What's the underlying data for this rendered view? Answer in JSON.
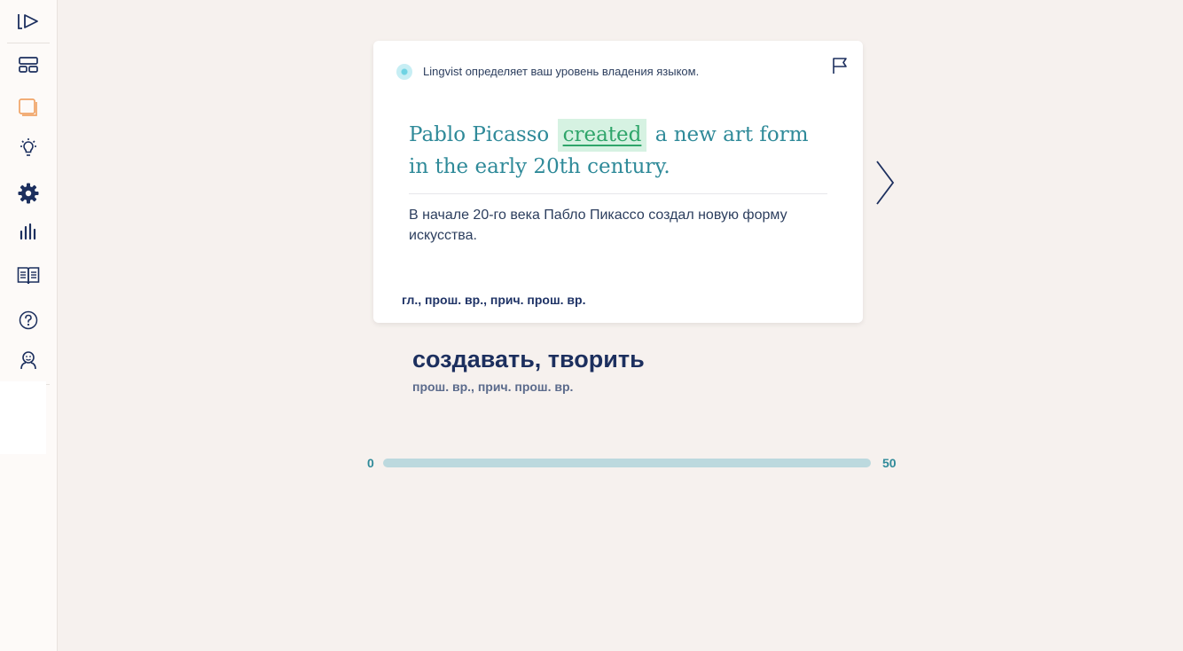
{
  "sidebar": {
    "items": [
      {
        "icon": "play-icon"
      },
      {
        "icon": "dashboard-icon"
      },
      {
        "icon": "cards-icon",
        "active_color": "#f0a466"
      },
      {
        "icon": "lightbulb-icon"
      },
      {
        "icon": "gear-icon"
      },
      {
        "icon": "stats-icon"
      },
      {
        "icon": "book-icon"
      },
      {
        "icon": "help-icon"
      },
      {
        "icon": "profile-icon"
      }
    ]
  },
  "card": {
    "status_text": "Lingvist определяет ваш уровень владения языком.",
    "sentence_before": "Pablo Picasso",
    "target_word": "created",
    "sentence_after": "a new art form in the early 20th century.",
    "translation": "В начале 20-го века Пабло Пикассо создал новую форму искусства.",
    "grammar": "гл., прош. вр., прич. прош. вр."
  },
  "meaning": {
    "word": "создавать, творить",
    "form": "прош. вр., прич. прош. вр."
  },
  "progress": {
    "min_label": "0",
    "max_label": "50",
    "fraction": 0
  },
  "colors": {
    "background": "#f6f1ee",
    "sentence": "#2f8a99",
    "target_highlight": "#d6f2e2",
    "target_text": "#2fa56a",
    "navy": "#1c2f5e",
    "accent_orange": "#f0a466",
    "progress_track": "#bcd9de"
  }
}
